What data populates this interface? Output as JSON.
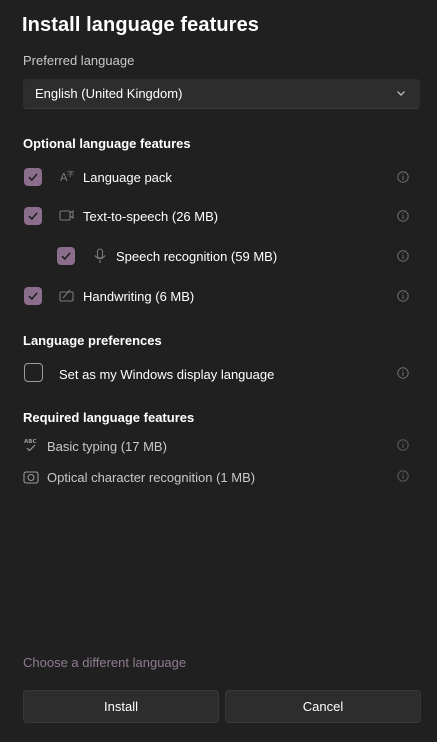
{
  "dialog": {
    "title": "Install language features",
    "preferred_language_label": "Preferred language",
    "preferred_language_value": "English (United Kingdom)"
  },
  "optional": {
    "heading": "Optional language features",
    "items": [
      {
        "label": "Language pack",
        "checked": true,
        "icon": "language-pack-icon"
      },
      {
        "label": "Text-to-speech (26 MB)",
        "checked": true,
        "icon": "text-to-speech-icon"
      },
      {
        "label": "Speech recognition (59 MB)",
        "checked": true,
        "icon": "microphone-icon"
      },
      {
        "label": "Handwriting (6 MB)",
        "checked": true,
        "icon": "handwriting-icon"
      }
    ]
  },
  "preferences": {
    "heading": "Language preferences",
    "items": [
      {
        "label": "Set as my Windows display language",
        "checked": false
      }
    ]
  },
  "required": {
    "heading": "Required language features",
    "items": [
      {
        "label": "Basic typing (17 MB)",
        "icon": "spell-check-icon"
      },
      {
        "label": "Optical character recognition (1 MB)",
        "icon": "ocr-icon"
      }
    ]
  },
  "footer": {
    "link": "Choose a different language",
    "install_label": "Install",
    "cancel_label": "Cancel"
  },
  "colors": {
    "background": "#202020",
    "accent_checkbox": "#8a6e8c",
    "link": "#8e7d90",
    "button": "#2d2d2d"
  }
}
